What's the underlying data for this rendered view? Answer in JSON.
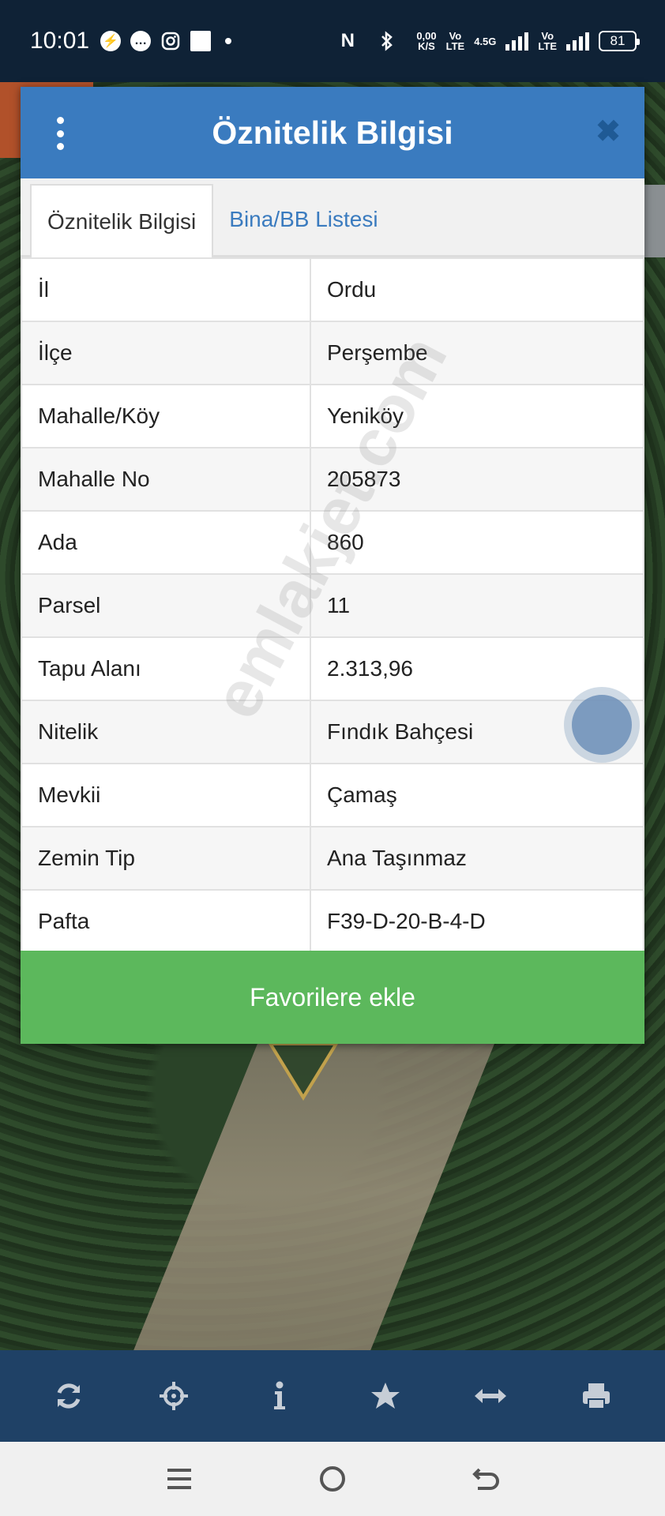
{
  "status_bar": {
    "time": "10:01",
    "net_speed": "0,00\nK/S",
    "lte1": "Vo\nLTE",
    "lte_4g": "4.5G",
    "lte2": "Vo\nLTE",
    "battery": "81"
  },
  "dialog": {
    "title": "Öznitelik Bilgisi",
    "tabs": [
      {
        "label": "Öznitelik Bilgisi",
        "active": true
      },
      {
        "label": "Bina/BB Listesi",
        "active": false
      }
    ],
    "rows": [
      {
        "label": "İl",
        "value": "Ordu"
      },
      {
        "label": "İlçe",
        "value": "Perşembe"
      },
      {
        "label": "Mahalle/Köy",
        "value": "Yeniköy"
      },
      {
        "label": "Mahalle No",
        "value": "205873"
      },
      {
        "label": "Ada",
        "value": "860"
      },
      {
        "label": "Parsel",
        "value": "11"
      },
      {
        "label": "Tapu Alanı",
        "value": "2.313,96"
      },
      {
        "label": "Nitelik",
        "value": "Fındık Bahçesi"
      },
      {
        "label": "Mevkii",
        "value": "Çamaş"
      },
      {
        "label": "Zemin Tip",
        "value": "Ana Taşınmaz"
      },
      {
        "label": "Pafta",
        "value": "F39-D-20-B-4-D"
      }
    ],
    "favorite_label": "Favorilere ekle"
  },
  "watermark": "emlakjet.com",
  "toolbar": {
    "icons": [
      "refresh-icon",
      "crosshair-icon",
      "info-icon",
      "star-icon",
      "measure-icon",
      "print-icon"
    ]
  },
  "navbar": {
    "icons": [
      "menu-icon",
      "home-icon",
      "back-icon"
    ]
  },
  "colors": {
    "header": "#3a7bbf",
    "favorite": "#5cb85c",
    "toolbar": "#1f4166",
    "status_bar": "#0f2236"
  }
}
